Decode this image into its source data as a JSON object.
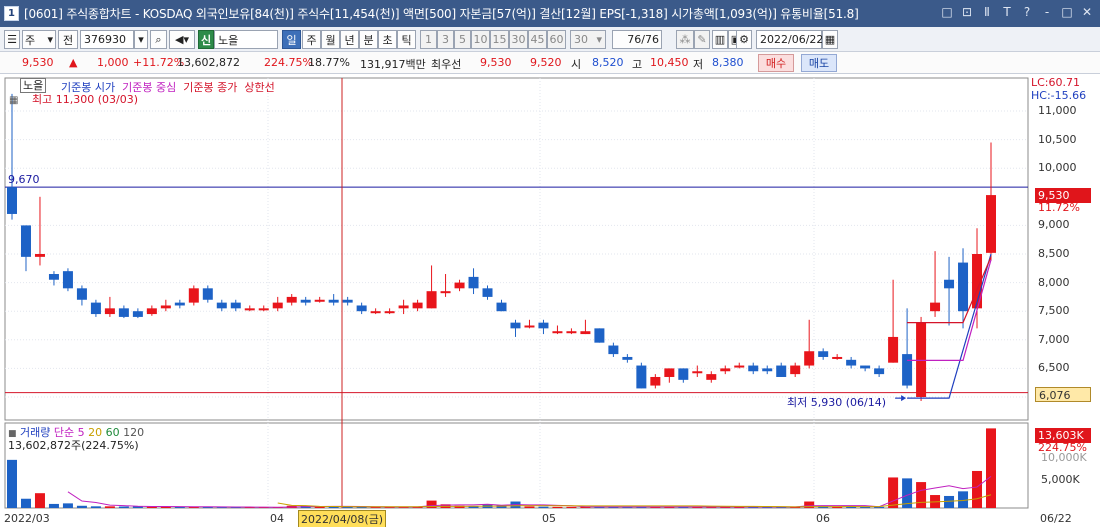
{
  "window": {
    "number": "1",
    "title": "[0601] 주식종합차트 - KOSDAQ 외국인보유[84(천)] 주식수[11,454(천)] 액면[500] 자본금[57(억)] 결산[12월] EPS[-1,318] 시가총액[1,093(억)] 유통비율[51.8]",
    "buttons": [
      "□",
      "⊡",
      "Ⅱ",
      "T",
      "?",
      "-",
      "□",
      "✕"
    ]
  },
  "toolbar": {
    "type_select": "주",
    "prev_label": "전",
    "code": "376930",
    "stock_badge": "신",
    "stock_name": "노을",
    "periods": [
      "일",
      "주",
      "월",
      "년",
      "분",
      "초",
      "틱"
    ],
    "active_period": "일",
    "intervals": [
      "1",
      "3",
      "5",
      "10",
      "15",
      "30",
      "45",
      "60"
    ],
    "interval_value": "30",
    "count_value": "76",
    "count_total": "/76",
    "date_value": "2022/06/22"
  },
  "inforow": {
    "price": "9,530",
    "arrow": "▲",
    "change": "1,000",
    "change_pct": "+11.72%",
    "volume": "13,602,872",
    "vol_ratio": "224.75%",
    "turnover": "18.77%",
    "amount": "131,917백만",
    "quote_label": "최우선",
    "ask": "9,530",
    "bid": "9,520",
    "open_label": "시",
    "open": "8,520",
    "high_label": "고",
    "high": "10,450",
    "low_label": "저",
    "low": "8,380",
    "buy_btn": "매수",
    "sell_btn": "매도"
  },
  "price_panel": {
    "legend_stock": "노을",
    "legend_items": [
      {
        "text": "기준봉 시가",
        "color": "#1f3fbf"
      },
      {
        "text": "기준봉 중심",
        "color": "#c020c0"
      },
      {
        "text": "기준봉 종가",
        "color": "#d4142a"
      },
      {
        "text": "상한선",
        "color": "#d4142a"
      }
    ],
    "max_label": "최고 11,300 (03/03)",
    "min_label": "최저 5,930 (06/14)",
    "ref_label": "9,670",
    "lc_label": "LC:60.71",
    "hc_label": "HC:-15.66",
    "current_tag": "9,530",
    "current_pct": "11.72%",
    "low_tag": "6,076",
    "y_ticks": [
      "11,000",
      "10,500",
      "10,000",
      "9,000",
      "8,500",
      "8,000",
      "7,500",
      "7,000",
      "6,500",
      "6,000"
    ]
  },
  "volume_panel": {
    "legend_title": "거래량",
    "legend_ma": "단순",
    "ma_periods": [
      {
        "p": "5",
        "color": "#c020c0"
      },
      {
        "p": "20",
        "color": "#c8a000"
      },
      {
        "p": "60",
        "color": "#1e8a3a"
      },
      {
        "p": "120",
        "color": "#555555"
      }
    ],
    "volume_text": "13,602,872주(224.75%)",
    "vol_tag": "13,603K",
    "vol_tag_pct": "224.75%",
    "y_ticks": [
      "10,000K",
      "5,000K"
    ]
  },
  "x_axis": {
    "labels": [
      "2022/03",
      "04",
      "05",
      "06",
      "06/22"
    ],
    "cursor_date": "2022/04/08(금)"
  },
  "colors": {
    "up": "#e8151b",
    "down": "#1d62c6",
    "ref_line": "#1a1aa0",
    "low_line": "#d4142a"
  },
  "chart_data": {
    "type": "candlestick",
    "ylim": [
      5800,
      11300
    ],
    "candles": [
      {
        "o": 9670,
        "c": 9200,
        "h": 11300,
        "l": 9100
      },
      {
        "o": 9000,
        "c": 8450,
        "h": 9000,
        "l": 8200
      },
      {
        "o": 8450,
        "c": 8500,
        "h": 9500,
        "l": 8300
      },
      {
        "o": 8150,
        "c": 8050,
        "h": 8200,
        "l": 7950
      },
      {
        "o": 8200,
        "c": 7900,
        "h": 8250,
        "l": 7850
      },
      {
        "o": 7900,
        "c": 7700,
        "h": 7950,
        "l": 7600
      },
      {
        "o": 7650,
        "c": 7450,
        "h": 7700,
        "l": 7400
      },
      {
        "o": 7450,
        "c": 7550,
        "h": 7750,
        "l": 7400
      },
      {
        "o": 7550,
        "c": 7400,
        "h": 7600,
        "l": 7380
      },
      {
        "o": 7500,
        "c": 7400,
        "h": 7550,
        "l": 7380
      },
      {
        "o": 7450,
        "c": 7550,
        "h": 7600,
        "l": 7420
      },
      {
        "o": 7550,
        "c": 7600,
        "h": 7700,
        "l": 7500
      },
      {
        "o": 7650,
        "c": 7600,
        "h": 7700,
        "l": 7550
      },
      {
        "o": 7650,
        "c": 7900,
        "h": 7950,
        "l": 7600
      },
      {
        "o": 7900,
        "c": 7700,
        "h": 7950,
        "l": 7650
      },
      {
        "o": 7650,
        "c": 7550,
        "h": 7700,
        "l": 7500
      },
      {
        "o": 7650,
        "c": 7550,
        "h": 7700,
        "l": 7500
      },
      {
        "o": 7550,
        "c": 7550,
        "h": 7600,
        "l": 7500
      },
      {
        "o": 7550,
        "c": 7550,
        "h": 7600,
        "l": 7500
      },
      {
        "o": 7550,
        "c": 7650,
        "h": 7750,
        "l": 7500
      },
      {
        "o": 7650,
        "c": 7750,
        "h": 7800,
        "l": 7600
      },
      {
        "o": 7700,
        "c": 7650,
        "h": 7750,
        "l": 7600
      },
      {
        "o": 7700,
        "c": 7700,
        "h": 7750,
        "l": 7650
      },
      {
        "o": 7700,
        "c": 7650,
        "h": 7800,
        "l": 7600
      },
      {
        "o": 7700,
        "c": 7650,
        "h": 7750,
        "l": 7600
      },
      {
        "o": 7600,
        "c": 7500,
        "h": 7650,
        "l": 7450
      },
      {
        "o": 7500,
        "c": 7500,
        "h": 7550,
        "l": 7450
      },
      {
        "o": 7500,
        "c": 7500,
        "h": 7550,
        "l": 7450
      },
      {
        "o": 7550,
        "c": 7600,
        "h": 7700,
        "l": 7450
      },
      {
        "o": 7550,
        "c": 7650,
        "h": 7700,
        "l": 7500
      },
      {
        "o": 7550,
        "c": 7850,
        "h": 8300,
        "l": 7550
      },
      {
        "o": 7850,
        "c": 7850,
        "h": 8150,
        "l": 7750
      },
      {
        "o": 7900,
        "c": 8000,
        "h": 8050,
        "l": 7850
      },
      {
        "o": 8100,
        "c": 7900,
        "h": 8250,
        "l": 7800
      },
      {
        "o": 7900,
        "c": 7750,
        "h": 7950,
        "l": 7700
      },
      {
        "o": 7650,
        "c": 7500,
        "h": 7700,
        "l": 7500
      },
      {
        "o": 7300,
        "c": 7200,
        "h": 7350,
        "l": 7050
      },
      {
        "o": 7250,
        "c": 7250,
        "h": 7350,
        "l": 7200
      },
      {
        "o": 7300,
        "c": 7200,
        "h": 7350,
        "l": 7100
      },
      {
        "o": 7150,
        "c": 7150,
        "h": 7250,
        "l": 7100
      },
      {
        "o": 7150,
        "c": 7150,
        "h": 7200,
        "l": 7100
      },
      {
        "o": 7100,
        "c": 7150,
        "h": 7350,
        "l": 7100
      },
      {
        "o": 7200,
        "c": 6950,
        "h": 7200,
        "l": 6950
      },
      {
        "o": 6900,
        "c": 6750,
        "h": 6950,
        "l": 6700
      },
      {
        "o": 6700,
        "c": 6650,
        "h": 6750,
        "l": 6600
      },
      {
        "o": 6550,
        "c": 6150,
        "h": 6600,
        "l": 6150
      },
      {
        "o": 6200,
        "c": 6350,
        "h": 6400,
        "l": 6150
      },
      {
        "o": 6350,
        "c": 6500,
        "h": 6500,
        "l": 6250
      },
      {
        "o": 6500,
        "c": 6300,
        "h": 6500,
        "l": 6250
      },
      {
        "o": 6450,
        "c": 6450,
        "h": 6550,
        "l": 6350
      },
      {
        "o": 6300,
        "c": 6400,
        "h": 6450,
        "l": 6250
      },
      {
        "o": 6450,
        "c": 6500,
        "h": 6550,
        "l": 6400
      },
      {
        "o": 6550,
        "c": 6550,
        "h": 6600,
        "l": 6500
      },
      {
        "o": 6550,
        "c": 6450,
        "h": 6600,
        "l": 6400
      },
      {
        "o": 6500,
        "c": 6450,
        "h": 6550,
        "l": 6400
      },
      {
        "o": 6550,
        "c": 6350,
        "h": 6600,
        "l": 6350
      },
      {
        "o": 6400,
        "c": 6550,
        "h": 6600,
        "l": 6350
      },
      {
        "o": 6550,
        "c": 6800,
        "h": 7350,
        "l": 6500
      },
      {
        "o": 6800,
        "c": 6700,
        "h": 6850,
        "l": 6650
      },
      {
        "o": 6700,
        "c": 6700,
        "h": 6750,
        "l": 6650
      },
      {
        "o": 6650,
        "c": 6550,
        "h": 6700,
        "l": 6500
      },
      {
        "o": 6550,
        "c": 6500,
        "h": 6550,
        "l": 6450
      },
      {
        "o": 6500,
        "c": 6400,
        "h": 6550,
        "l": 6350
      },
      {
        "o": 6600,
        "c": 7050,
        "h": 8050,
        "l": 6600
      },
      {
        "o": 6750,
        "c": 6200,
        "h": 7550,
        "l": 6150
      },
      {
        "o": 6000,
        "c": 7300,
        "h": 7400,
        "l": 5930
      },
      {
        "o": 7500,
        "c": 7650,
        "h": 8550,
        "l": 7400
      },
      {
        "o": 8050,
        "c": 7900,
        "h": 8450,
        "l": 7250
      },
      {
        "o": 8350,
        "c": 7500,
        "h": 8600,
        "l": 7200
      },
      {
        "o": 7550,
        "c": 8500,
        "h": 8950,
        "l": 7200
      },
      {
        "o": 8520,
        "c": 9530,
        "h": 10450,
        "l": 8380
      }
    ],
    "volumes": [
      2600,
      500,
      800,
      220,
      250,
      120,
      90,
      90,
      80,
      80,
      70,
      70,
      60,
      70,
      60,
      50,
      40,
      40,
      40,
      40,
      120,
      120,
      80,
      70,
      60,
      70,
      60,
      60,
      60,
      60,
      400,
      200,
      120,
      80,
      200,
      150,
      350,
      80,
      70,
      60,
      60,
      70,
      60,
      60,
      50,
      70,
      60,
      60,
      60,
      60,
      50,
      70,
      60,
      70,
      50,
      60,
      70,
      350,
      100,
      60,
      70,
      60,
      60,
      1650,
      1600,
      1400,
      700,
      650,
      900,
      2000,
      4300
    ]
  }
}
